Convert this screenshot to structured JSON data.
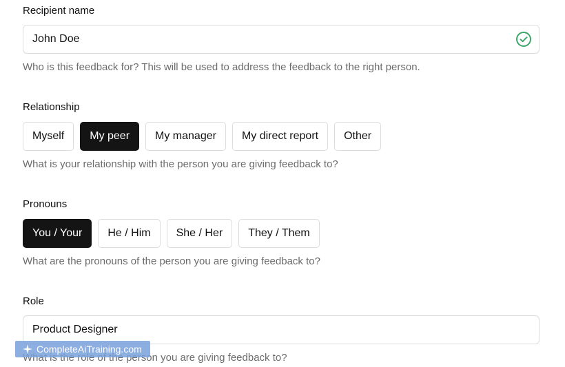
{
  "recipient": {
    "label": "Recipient name",
    "value": "John Doe",
    "status_icon": "check-circle-icon",
    "status_color": "#3fa66b",
    "hint": "Who is this feedback for? This will be used to address the feedback to the right person."
  },
  "relationship": {
    "label": "Relationship",
    "options": [
      "Myself",
      "My peer",
      "My manager",
      "My direct report",
      "Other"
    ],
    "selected": "My peer",
    "hint": "What is your relationship with the person you are giving feedback to?"
  },
  "pronouns": {
    "label": "Pronouns",
    "options": [
      "You / Your",
      "He / Him",
      "She / Her",
      "They / Them"
    ],
    "selected": "You / Your",
    "hint": "What are the pronouns of the person you are giving feedback to?"
  },
  "role": {
    "label": "Role",
    "value": "Product Designer",
    "hint": "What is the role of the person you are giving feedback to?"
  },
  "watermark": {
    "text": "CompleteAiTraining.com"
  }
}
